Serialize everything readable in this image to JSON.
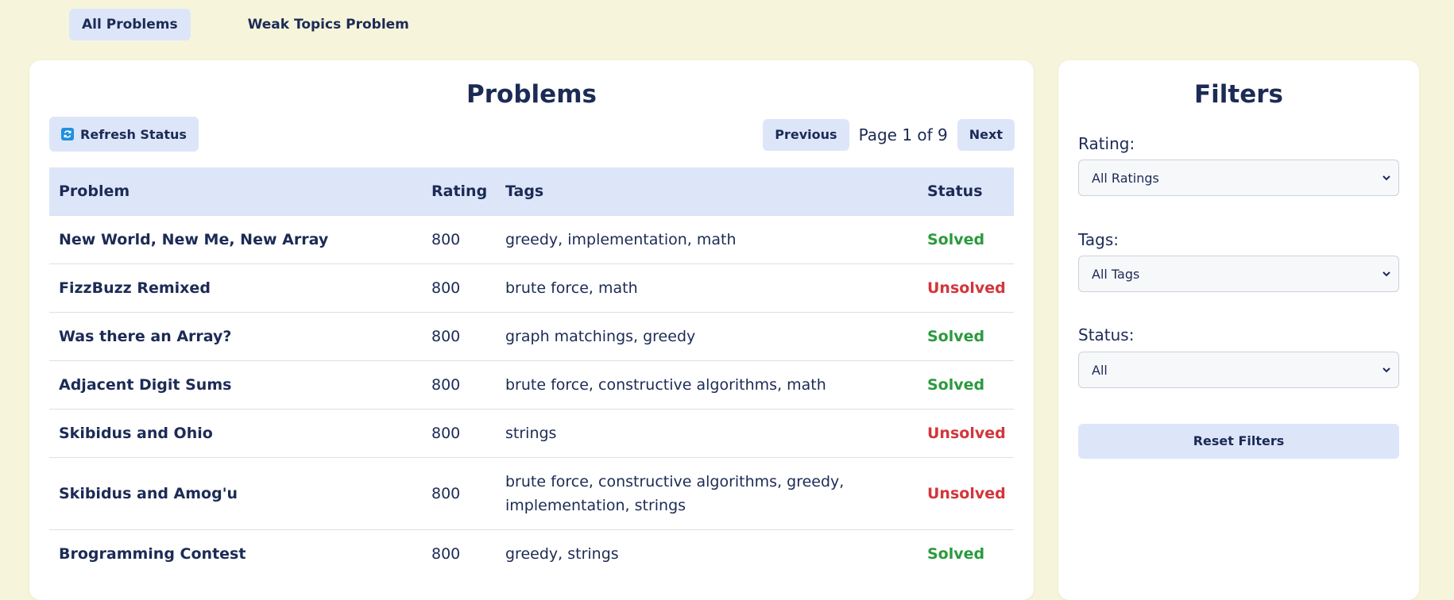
{
  "nav": {
    "tabs": [
      {
        "label": "All Problems"
      },
      {
        "label": "Weak Topics Problem"
      }
    ]
  },
  "problems": {
    "title": "Problems",
    "refresh_label": "Refresh Status",
    "pager": {
      "previous_label": "Previous",
      "page_info": "Page 1 of 9",
      "next_label": "Next"
    },
    "columns": [
      "Problem",
      "Rating",
      "Tags",
      "Status"
    ],
    "rows": [
      {
        "name": "New World, New Me, New Array",
        "rating": "800",
        "tags": "greedy, implementation, math",
        "status": "Solved"
      },
      {
        "name": "FizzBuzz Remixed",
        "rating": "800",
        "tags": "brute force, math",
        "status": "Unsolved"
      },
      {
        "name": "Was there an Array?",
        "rating": "800",
        "tags": "graph matchings, greedy",
        "status": "Solved"
      },
      {
        "name": "Adjacent Digit Sums",
        "rating": "800",
        "tags": "brute force, constructive algorithms, math",
        "status": "Solved"
      },
      {
        "name": "Skibidus and Ohio",
        "rating": "800",
        "tags": "strings",
        "status": "Unsolved"
      },
      {
        "name": "Skibidus and Amog'u",
        "rating": "800",
        "tags": "brute force, constructive algorithms, greedy, implementation, strings",
        "status": "Unsolved"
      },
      {
        "name": "Brogramming Contest",
        "rating": "800",
        "tags": "greedy, strings",
        "status": "Solved"
      }
    ]
  },
  "filters": {
    "title": "Filters",
    "rating_label": "Rating:",
    "rating_value": "All Ratings",
    "tags_label": "Tags:",
    "tags_value": "All Tags",
    "status_label": "Status:",
    "status_value": "All",
    "reset_label": "Reset Filters"
  },
  "colors": {
    "background": "#f6f5dc",
    "accent": "#dde6f9",
    "text": "#1c2b55",
    "solved": "#2b9a3e",
    "unsolved": "#d3353b"
  }
}
